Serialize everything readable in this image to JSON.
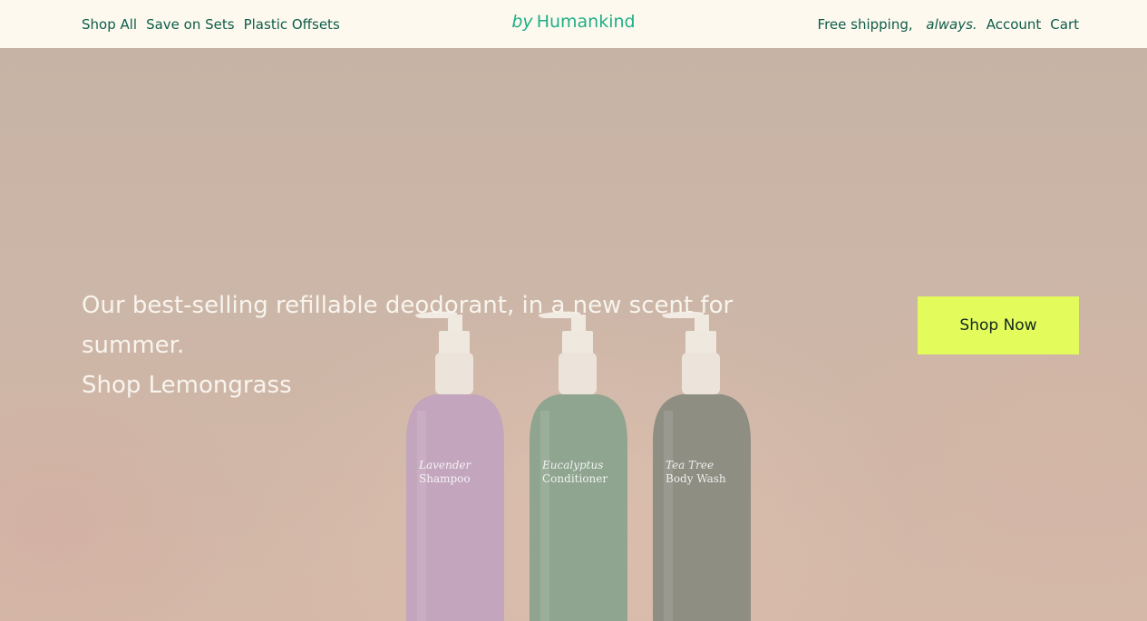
{
  "nav": {
    "left_links": [
      "Shop All",
      "Save on Sets",
      "Plastic Offsets"
    ],
    "logo_prefix": "by",
    "logo_name": "Humankind",
    "shipping_prefix": "Free shipping,",
    "shipping_emphasis": "always.",
    "account_label": "Account",
    "cart_label": "Cart"
  },
  "hero": {
    "headline_line1": "Our best-selling refillable deodorant, in a new scent for summer.",
    "headline_line2": "Shop Lemongrass",
    "cta_label": "Shop Now",
    "bottles": [
      {
        "scent": "Lavender",
        "kind": "Shampoo",
        "color": "#c3a5bd"
      },
      {
        "scent": "Eucalyptus",
        "kind": "Conditioner",
        "color": "#8fa590"
      },
      {
        "scent": "Tea Tree",
        "kind": "Body Wash",
        "color": "#8e8e83"
      }
    ]
  },
  "colors": {
    "nav_bg": "#fdf9ef",
    "nav_text": "#0e5c4a",
    "logo": "#1fae87",
    "cta_bg": "#e3fb5b",
    "hero_bg": "#cbb4a5"
  }
}
